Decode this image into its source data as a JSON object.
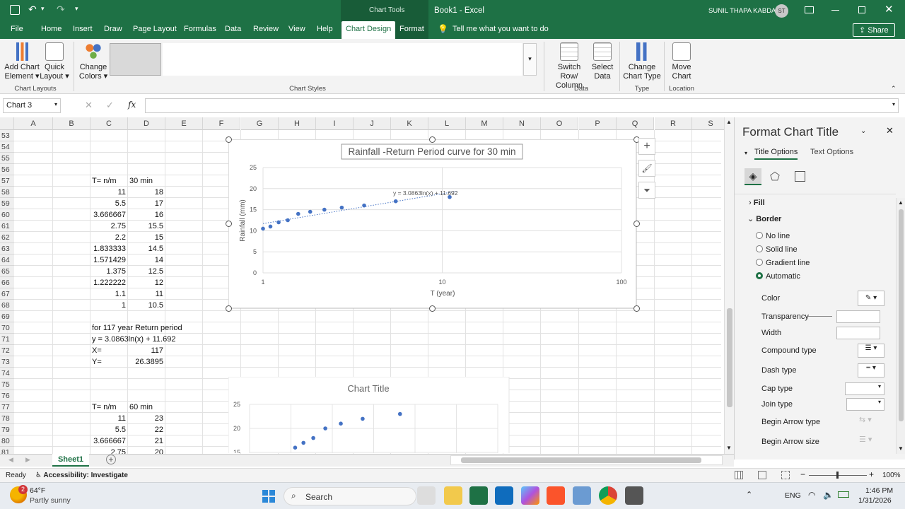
{
  "titlebar": {
    "chart_tools": "Chart Tools",
    "doc_title": "Book1  -  Excel",
    "user_name": "SUNIL THAPA KABDAR",
    "user_initials": "ST"
  },
  "tabs": [
    "File",
    "Home",
    "Insert",
    "Draw",
    "Page Layout",
    "Formulas",
    "Data",
    "Review",
    "View",
    "Help",
    "Chart Design",
    "Format"
  ],
  "tell_me": "Tell me what you want to do",
  "share_label": "Share",
  "ribbon": {
    "add_chart": [
      "Add Chart",
      "Element"
    ],
    "quick_layout": [
      "Quick",
      "Layout"
    ],
    "change_colors": [
      "Change",
      "Colors"
    ],
    "switch_row": [
      "Switch Row/",
      "Column"
    ],
    "select_data": [
      "Select",
      "Data"
    ],
    "change_type": [
      "Change",
      "Chart Type"
    ],
    "move_chart": [
      "Move",
      "Chart"
    ],
    "groups": {
      "layouts": "Chart Layouts",
      "styles": "Chart Styles",
      "data": "Data",
      "type": "Type",
      "location": "Location"
    }
  },
  "formula_bar": {
    "name_box": "Chart 3",
    "fx": "fx",
    "value": ""
  },
  "columns": [
    "A",
    "B",
    "C",
    "D",
    "E",
    "F",
    "G",
    "H",
    "I",
    "J",
    "K",
    "L",
    "M",
    "N",
    "O",
    "P",
    "Q",
    "R",
    "S"
  ],
  "rows": [
    "53",
    "54",
    "55",
    "56",
    "57",
    "58",
    "59",
    "60",
    "61",
    "62",
    "63",
    "64",
    "65",
    "66",
    "67",
    "68",
    "69",
    "70",
    "71",
    "72",
    "73",
    "74",
    "75",
    "76",
    "77",
    "78",
    "79",
    "80",
    "81"
  ],
  "cells": {
    "r57": {
      "c": "T= n/m",
      "d": "30 min"
    },
    "table1": [
      [
        "11",
        "18"
      ],
      [
        "5.5",
        "17"
      ],
      [
        "3.666667",
        "16"
      ],
      [
        "2.75",
        "15.5"
      ],
      [
        "2.2",
        "15"
      ],
      [
        "1.833333",
        "14.5"
      ],
      [
        "1.571429",
        "14"
      ],
      [
        "1.375",
        "12.5"
      ],
      [
        "1.222222",
        "12"
      ],
      [
        "1.1",
        "11"
      ],
      [
        "1",
        "10.5"
      ]
    ],
    "r70": "for  117 year Return period",
    "r71": "y = 3.0863ln(x) + 11.692",
    "r72": {
      "c": "X=",
      "d": "117"
    },
    "r73": {
      "c": "Y=",
      "d": "26.3895"
    },
    "r77": {
      "c": "T= n/m",
      "d": "60 min"
    },
    "table2": [
      [
        "11",
        "23"
      ],
      [
        "5.5",
        "22"
      ],
      [
        "3.666667",
        "21"
      ],
      [
        "2.75",
        "20"
      ]
    ]
  },
  "chart_data": [
    {
      "type": "scatter",
      "title": "Rainfall -Return Period curve for 30 min",
      "xlabel": "T (year)",
      "ylabel": "Rainfall (mm)",
      "x_scale": "log",
      "xlim": [
        1,
        100
      ],
      "ylim": [
        0,
        25
      ],
      "x_ticks": [
        "1",
        "10",
        "100"
      ],
      "y_ticks": [
        "0",
        "5",
        "10",
        "15",
        "20",
        "25"
      ],
      "grid": true,
      "trendline_label": "y = 3.0863ln(x) + 11.692",
      "trendline": {
        "a": 3.0863,
        "b": 11.692
      },
      "series": [
        {
          "x": [
            1,
            1.1,
            1.222222,
            1.375,
            1.571429,
            1.833333,
            2.2,
            2.75,
            3.666667,
            5.5,
            11
          ],
          "y": [
            10.5,
            11,
            12,
            12.5,
            14,
            14.5,
            15,
            15.5,
            16,
            17,
            18
          ]
        }
      ]
    },
    {
      "type": "scatter",
      "title": "Chart Title",
      "y_ticks": [
        "25",
        "20",
        "15"
      ],
      "ylim": [
        15,
        25
      ],
      "grid": true,
      "series": [
        {
          "x": [
            1.571429,
            1.833333,
            2.2,
            2.75,
            3.666667,
            5.5,
            11
          ],
          "y": [
            16,
            17,
            18,
            20,
            21,
            22,
            23
          ]
        }
      ]
    }
  ],
  "sheet_tab": "Sheet1",
  "pane": {
    "title": "Format Chart Title",
    "tab_title_options": "Title Options",
    "tab_text_options": "Text Options",
    "fill": "Fill",
    "border": "Border",
    "no_line": "No line",
    "solid_line": "Solid line",
    "gradient_line": "Gradient line",
    "automatic": "Automatic",
    "color": "Color",
    "transparency": "Transparency",
    "width": "Width",
    "compound_type": "Compound type",
    "dash_type": "Dash type",
    "cap_type": "Cap type",
    "join_type": "Join type",
    "begin_arrow_type": "Begin Arrow type",
    "begin_arrow_size": "Begin Arrow size"
  },
  "status": {
    "ready": "Ready",
    "accessibility": "Accessibility: Investigate",
    "zoom": "100%"
  },
  "taskbar": {
    "temp": "64°F",
    "weather": "Partly sunny",
    "badge": "2",
    "search": "Search",
    "lang": "ENG",
    "time": "1:46 PM",
    "date": "1/31/2026"
  },
  "colors": {
    "excel_green": "#1e7145",
    "point_blue": "#4472c4"
  }
}
